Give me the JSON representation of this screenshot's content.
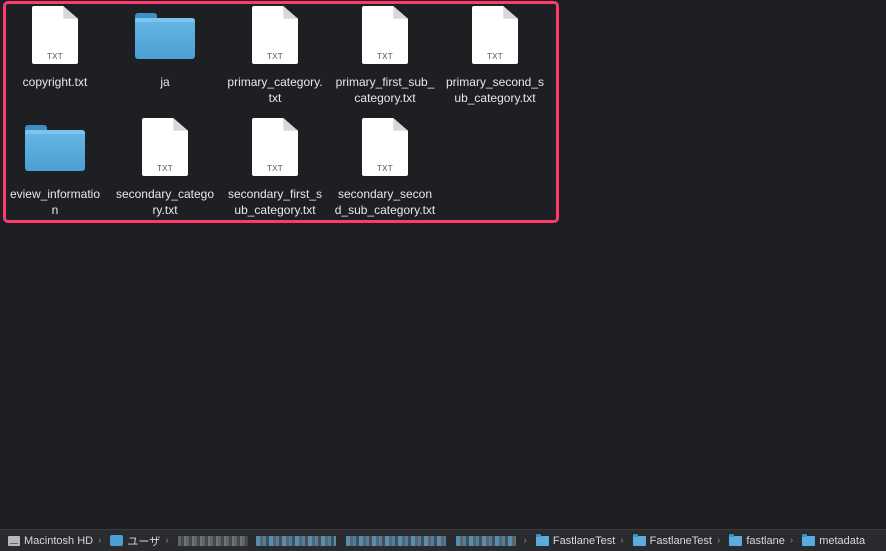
{
  "files": [
    {
      "name": "copyright.txt",
      "lines": [
        "copyright.txt"
      ],
      "kind": "text",
      "ext": "TXT"
    },
    {
      "name": "ja",
      "lines": [
        "ja"
      ],
      "kind": "folder"
    },
    {
      "name": "primary_category.txt",
      "lines": [
        "primary_category.",
        "txt"
      ],
      "kind": "text",
      "ext": "TXT"
    },
    {
      "name": "primary_first_sub_category.txt",
      "lines": [
        "primary_first_sub_",
        "category.txt"
      ],
      "kind": "text",
      "ext": "TXT"
    },
    {
      "name": "primary_second_sub_category.txt",
      "lines": [
        "primary_second_s",
        "ub_category.txt"
      ],
      "kind": "text",
      "ext": "TXT"
    },
    {
      "name": "review_information",
      "lines": [
        "eview_informatio",
        "n"
      ],
      "kind": "folder"
    },
    {
      "name": "secondary_category.txt",
      "lines": [
        "secondary_catego",
        "ry.txt"
      ],
      "kind": "text",
      "ext": "TXT"
    },
    {
      "name": "secondary_first_sub_category.txt",
      "lines": [
        "secondary_first_s",
        "ub_category.txt"
      ],
      "kind": "text",
      "ext": "TXT"
    },
    {
      "name": "secondary_second_sub_category.txt",
      "lines": [
        "secondary_secon",
        "d_sub_category.txt"
      ],
      "kind": "text",
      "ext": "TXT"
    }
  ],
  "pathbar": {
    "items": [
      {
        "label": "Macintosh HD",
        "icon": "hard-drive-icon"
      },
      {
        "label": "ユーザ",
        "icon": "user-folder-icon"
      },
      {
        "label": "FastlaneTest",
        "icon": "folder-icon"
      },
      {
        "label": "FastlaneTest",
        "icon": "folder-icon"
      },
      {
        "label": "fastlane",
        "icon": "folder-icon"
      },
      {
        "label": "metadata",
        "icon": "folder-icon"
      }
    ],
    "separator": "›"
  },
  "colors": {
    "background": "#1e1f23",
    "highlight": "#fc3b6d",
    "folder": "#4a9fd4"
  }
}
